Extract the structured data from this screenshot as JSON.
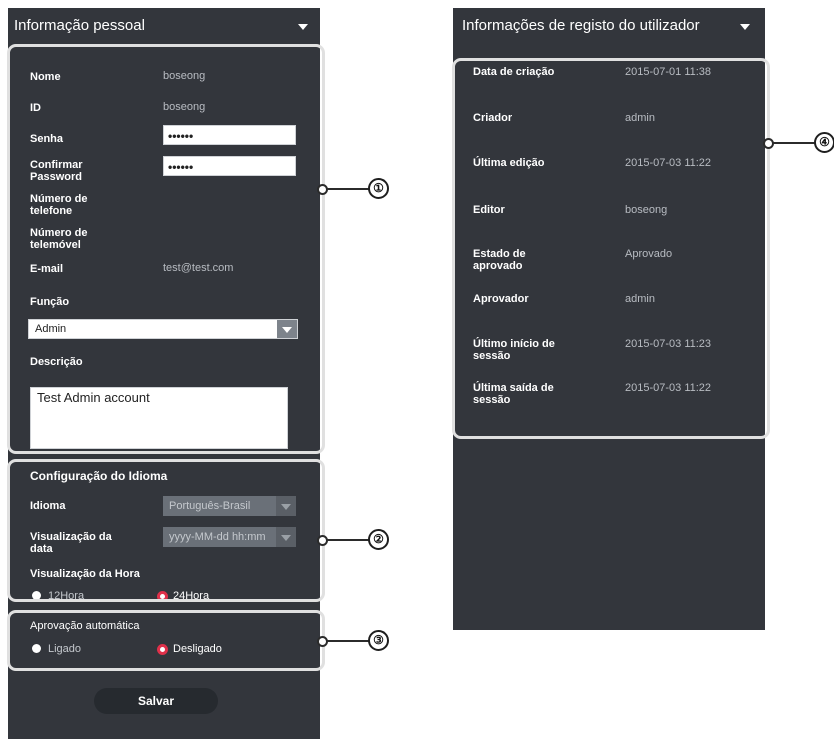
{
  "personal": {
    "title": "Informação pessoal",
    "name_label": "Nome",
    "name_value": "boseong",
    "id_label": "ID",
    "id_value": "boseong",
    "password_label": "Senha",
    "password_value": "••••••",
    "confirm_label_1": "Confirmar",
    "confirm_label_2": "Password",
    "confirm_value": "••••••",
    "phone_label_1": "Número de",
    "phone_label_2": "telefone",
    "mobile_label_1": "Número de",
    "mobile_label_2": "telemóvel",
    "email_label": "E-mail",
    "email_value": "test@test.com",
    "role_label": "Função",
    "role_value": "Admin",
    "desc_label": "Descrição",
    "desc_value": "Test Admin account"
  },
  "language": {
    "title": "Configuração do Idioma",
    "lang_label": "Idioma",
    "lang_value": "Português-Brasil",
    "date_label_1": "Visualização da",
    "date_label_2": "data",
    "date_value": "yyyy-MM-dd hh:mm",
    "time_label": "Visualização da Hora",
    "opt_12": "12Hora",
    "opt_24": "24Hora",
    "selected": "24Hora"
  },
  "approval": {
    "title": "Aprovação automática",
    "opt_on": "Ligado",
    "opt_off": "Desligado",
    "selected": "Desligado"
  },
  "save_label": "Salvar",
  "registration": {
    "title": "Informações de registo do utilizador",
    "rows": [
      {
        "label1": "Data de criação",
        "label2": "",
        "value": "2015-07-01 11:38"
      },
      {
        "label1": "Criador",
        "label2": "",
        "value": "admin"
      },
      {
        "label1": "Última edição",
        "label2": "",
        "value": "2015-07-03 11:22"
      },
      {
        "label1": "Editor",
        "label2": "",
        "value": "boseong"
      },
      {
        "label1": "Estado de",
        "label2": "aprovado",
        "value": "Aprovado"
      },
      {
        "label1": "Aprovador",
        "label2": "",
        "value": "admin"
      },
      {
        "label1": "Último início de",
        "label2": "sessão",
        "value": "2015-07-03 11:23"
      },
      {
        "label1": "Última saída de",
        "label2": "sessão",
        "value": "2015-07-03 11:22"
      }
    ]
  },
  "callouts": [
    "①",
    "②",
    "③",
    "④"
  ],
  "colors": {
    "panel": "#33363c",
    "highlight_border": "#e0e0e0",
    "radio_selected": "#e0304a",
    "text_value": "#b8bcc2"
  }
}
